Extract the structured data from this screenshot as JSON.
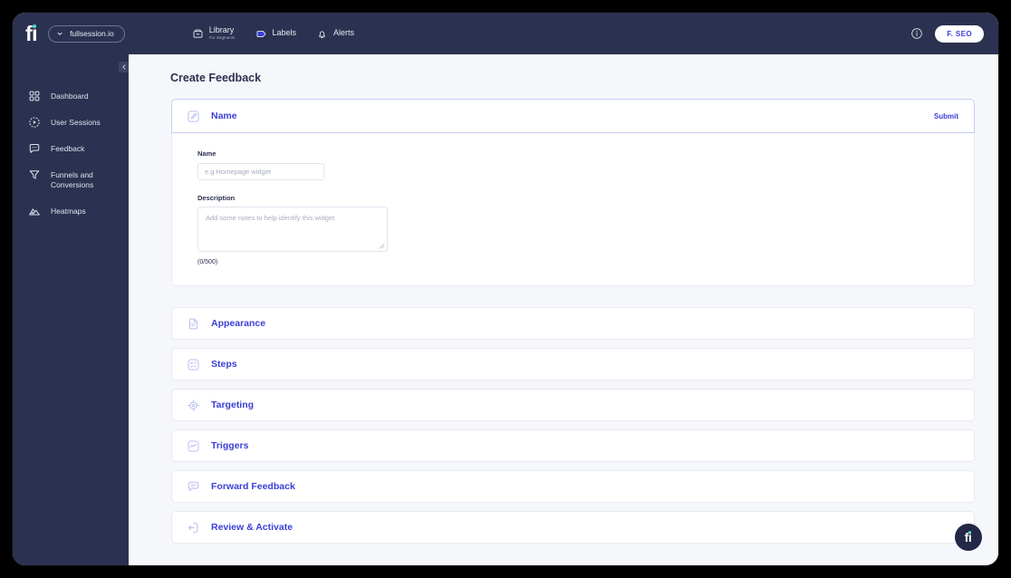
{
  "brand": {
    "logo_text": "fi",
    "site_name": "fullsession.io"
  },
  "topnav": {
    "items": [
      {
        "label": "Library",
        "sub": "For Segments",
        "icon": "archive-icon"
      },
      {
        "label": "Labels",
        "sub": "",
        "icon": "tag-icon"
      },
      {
        "label": "Alerts",
        "sub": "",
        "icon": "bell-icon"
      }
    ],
    "info_icon": "info-icon",
    "account_badge": "F. SEO"
  },
  "sidebar": {
    "items": [
      {
        "label": "Dashboard",
        "icon": "grid-icon"
      },
      {
        "label": "User Sessions",
        "icon": "play-circle-icon"
      },
      {
        "label": "Feedback",
        "icon": "chat-bubble-icon"
      },
      {
        "label": "Funnels and Conversions",
        "icon": "funnel-icon"
      },
      {
        "label": "Heatmaps",
        "icon": "mountain-icon"
      }
    ]
  },
  "main": {
    "page_title": "Create Feedback",
    "name_section": {
      "title": "Name",
      "icon": "edit-pencil-icon",
      "submit_label": "Submit",
      "name_label": "Name",
      "name_value": "",
      "name_placeholder": "e.g Homepage widget",
      "description_label": "Description",
      "description_value": "",
      "description_placeholder": "Add some notes to help identify this widget",
      "char_count": "(0/500)"
    },
    "sections": [
      {
        "title": "Appearance",
        "icon": "document-icon"
      },
      {
        "title": "Steps",
        "icon": "checklist-icon"
      },
      {
        "title": "Targeting",
        "icon": "crosshair-icon"
      },
      {
        "title": "Triggers",
        "icon": "pulse-icon"
      },
      {
        "title": "Forward Feedback",
        "icon": "chat-forward-icon"
      },
      {
        "title": "Review & Activate",
        "icon": "arrow-box-icon"
      }
    ]
  },
  "fab": {
    "logo_text": "fi"
  },
  "colors": {
    "header_navy": "#2b3150",
    "accent_blue": "#3b3fd6",
    "page_bg": "#f6f7fb",
    "brand_teal": "#4ed6c6"
  }
}
